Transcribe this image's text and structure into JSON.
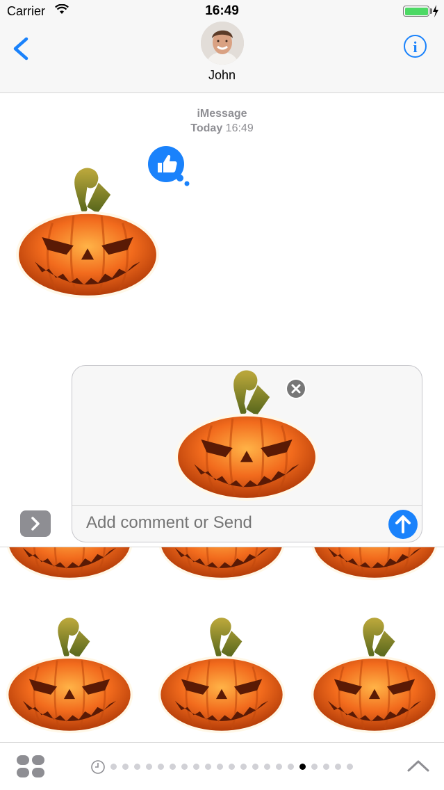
{
  "status_bar": {
    "carrier": "Carrier",
    "time": "16:49",
    "battery_color": "#4cd964"
  },
  "header": {
    "contact_name": "John",
    "back_icon": "chevron-left-icon",
    "info_icon": "info-circle-icon",
    "accent": "#1a82fb"
  },
  "thread": {
    "service": "iMessage",
    "day": "Today",
    "time": "16:49",
    "reaction_icon": "thumbs-up-icon"
  },
  "compose": {
    "placeholder": "Add comment or Send",
    "send_icon": "arrow-up-icon",
    "remove_icon": "close-icon",
    "expand_icon": "chevron-right-icon"
  },
  "bottom_bar": {
    "apps_icon": "app-drawer-icon",
    "recents_icon": "clock-icon",
    "collapse_icon": "chevron-up-icon",
    "page_count": 21,
    "active_page": 16
  },
  "colors": {
    "pumpkin": "#e8601a",
    "stem": "#7d8a2a",
    "accent": "#1a82fb"
  }
}
